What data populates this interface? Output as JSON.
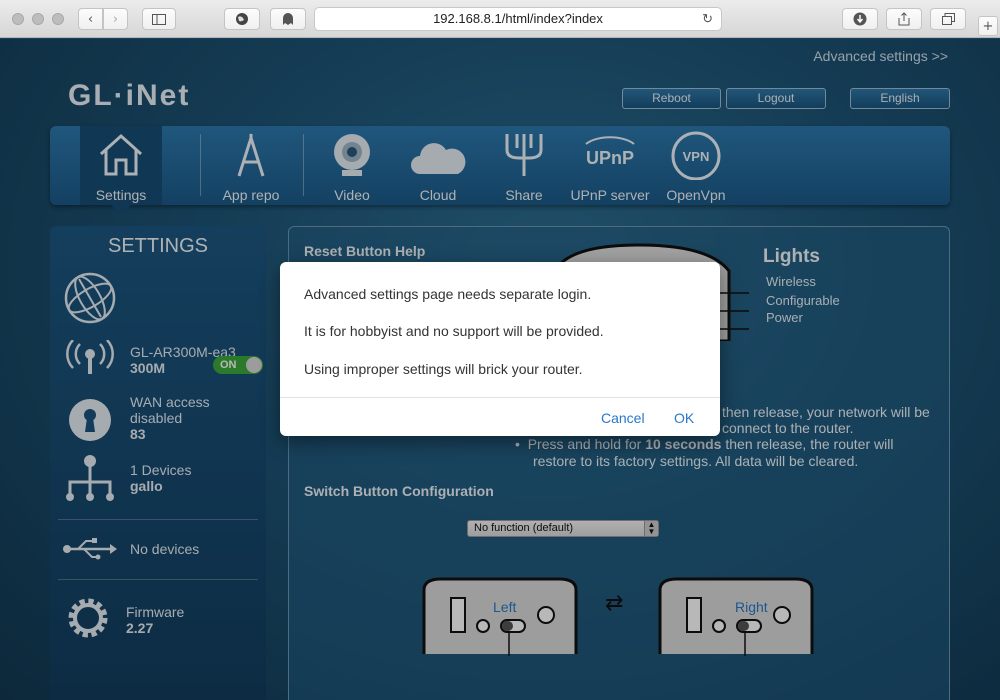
{
  "browser": {
    "url": "192.168.8.1/html/index?index"
  },
  "header": {
    "advanced_link": "Advanced settings >>",
    "logo": "GL·iNet",
    "reboot": "Reboot",
    "logout": "Logout",
    "language": "English"
  },
  "nav": {
    "items": [
      {
        "label": "Settings",
        "icon": "home-icon"
      },
      {
        "label": "App repo",
        "icon": "app-repo-icon"
      },
      {
        "label": "Video",
        "icon": "webcam-icon"
      },
      {
        "label": "Cloud",
        "icon": "cloud-icon"
      },
      {
        "label": "Share",
        "icon": "usb-share-icon"
      },
      {
        "label": "UPnP server",
        "icon": "upnp-icon"
      },
      {
        "label": "OpenVpn",
        "icon": "vpn-icon"
      }
    ],
    "upnp_badge": "UPnP",
    "vpn_badge": "VPN",
    "active": "Settings"
  },
  "sidebar": {
    "title": "SETTINGS",
    "wifi": {
      "name": "GL-AR300M-ea3",
      "detail": "300M",
      "toggle": "ON"
    },
    "wan": {
      "line1": "WAN access",
      "line2": "disabled",
      "value": "83"
    },
    "clients": {
      "line1": "1 Devices",
      "value": "gallo"
    },
    "usb": {
      "line1": "No devices"
    },
    "firmware": {
      "line1": "Firmware",
      "value": "2.27"
    }
  },
  "main": {
    "reset_title": "Reset Button Help",
    "lights_title": "Lights",
    "lights": [
      "Wireless",
      "Configurable",
      "Power"
    ],
    "bullet1_partial_a": "then release, your network will be",
    "bullet1_partial_b": "connect to the router.",
    "bullet2_pre": "Press and hold for ",
    "bullet2_bold": "10 seconds",
    "bullet2_post": " then release, the router will",
    "bullet2_line2": "restore to its factory settings. All data will be cleared.",
    "switch_title": "Switch Button Configuration",
    "switch_select": "No function (default)",
    "left_label": "Left",
    "right_label": "Right"
  },
  "modal": {
    "line1": "Advanced settings page needs separate login.",
    "line2": "It is for hobbyist and no support will be provided.",
    "line3": "Using improper settings will brick your router.",
    "cancel": "Cancel",
    "ok": "OK"
  },
  "colors": {
    "accent": "#2a78c8",
    "toggle_on": "#3caa3c",
    "nav_bg": "#2d79ad"
  }
}
